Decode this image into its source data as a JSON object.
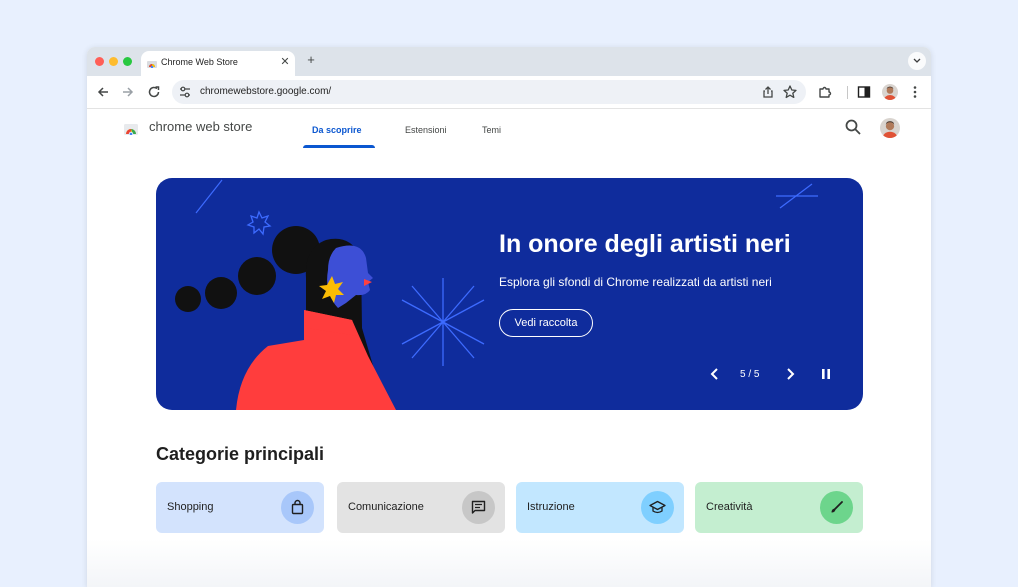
{
  "browser": {
    "tab_title": "Chrome Web Store",
    "url": "chromewebstore.google.com/"
  },
  "store": {
    "name": "chrome web store",
    "nav_tabs": [
      {
        "label": "Da scoprire",
        "active": true
      },
      {
        "label": "Estensioni",
        "active": false
      },
      {
        "label": "Temi",
        "active": false
      }
    ]
  },
  "hero": {
    "title": "In onore degli artisti neri",
    "subtitle": "Esplora gli sfondi di Chrome realizzati da artisti neri",
    "button_label": "Vedi raccolta",
    "counter": "5 / 5",
    "background_color": "#0f2c9c"
  },
  "categories": {
    "heading": "Categorie principali",
    "items": [
      {
        "label": "Shopping",
        "icon": "shopping-bag-icon",
        "card_color": "#d3e3fd",
        "icon_bg": "#a8c7fa"
      },
      {
        "label": "Comunicazione",
        "icon": "chat-icon",
        "card_color": "#e3e3e3",
        "icon_bg": "#c7c7c7"
      },
      {
        "label": "Istruzione",
        "icon": "graduation-cap-icon",
        "card_color": "#c2e7ff",
        "icon_bg": "#7fcfff"
      },
      {
        "label": "Creatività",
        "icon": "paint-brush-icon",
        "card_color": "#c4eed0",
        "icon_bg": "#6dd58c"
      }
    ]
  },
  "colors": {
    "accent": "#0b57d0",
    "page_background": "#e8f0fe"
  }
}
